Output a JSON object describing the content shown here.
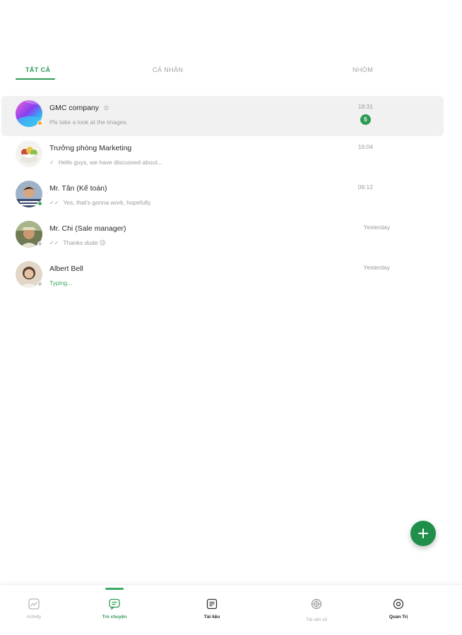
{
  "tabs": [
    {
      "label": "TẤT CẢ",
      "active": true
    },
    {
      "label": "CÁ NHÂN",
      "active": false
    },
    {
      "label": "NHÓM",
      "active": false
    }
  ],
  "chats": [
    {
      "name": "GMC company",
      "preview": "Pls take a look at the images.",
      "time": "18:31",
      "unread": "5",
      "selected": true,
      "status_color": "#f5a623",
      "tick": ""
    },
    {
      "name": "Trưởng phòng Marketing",
      "preview": "Hello guys, we have discussed about...",
      "time": "16:04",
      "tick": "✓"
    },
    {
      "name": "Mr. Tân (Kế toán)",
      "preview": "Yes, that's gonna work, hopefully.",
      "time": "06:12",
      "status_color": "#3aaa62",
      "tick": "✓✓"
    },
    {
      "name": "Mr. Chi (Sale manager)",
      "preview": "Thanks dude 😉",
      "time": "Yesterday",
      "status_color": "#c8c8c8",
      "tick": "✓✓"
    },
    {
      "name": "Albert Bell",
      "preview": "Typing...",
      "time": "Yesterday",
      "status_color": "#c8c8c8",
      "tick": ""
    }
  ],
  "bottom_nav": [
    {
      "label": "Activity",
      "icon": "activity-icon"
    },
    {
      "label": "Trò chuyện",
      "icon": "chat-icon",
      "active": true
    },
    {
      "label": "Tài liệu",
      "icon": "document-icon"
    },
    {
      "label": "Tài sản số",
      "icon": "digital-asset-icon"
    },
    {
      "label": "Quản Trị",
      "icon": "settings-icon"
    }
  ],
  "colors": {
    "accent": "#2e9a56",
    "fab": "#1f8f4b"
  }
}
